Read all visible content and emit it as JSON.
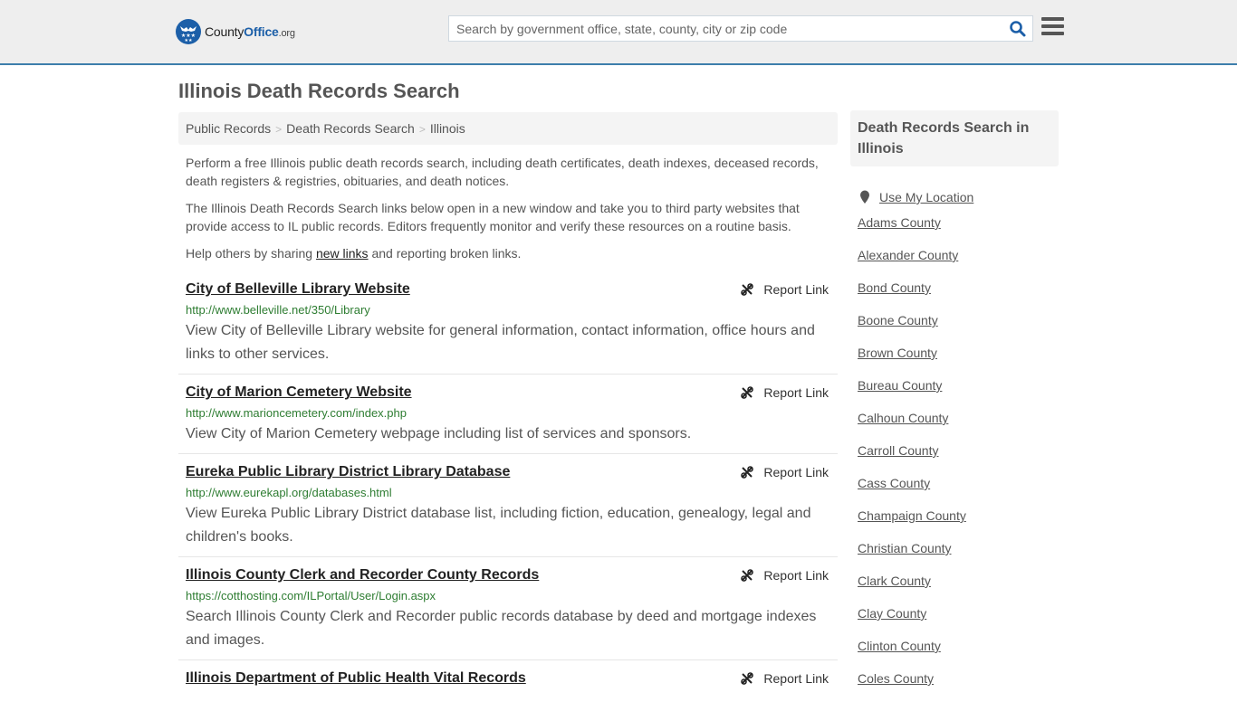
{
  "header": {
    "logo": {
      "prefix": "County",
      "brand": "Office",
      "tld": ".org"
    },
    "search_placeholder": "Search by government office, state, county, city or zip code",
    "search_value": "",
    "icons": {
      "search": "search-icon",
      "menu": "hamburger-menu-icon"
    },
    "accent_color": "#3d7eab"
  },
  "page": {
    "title": "Illinois Death Records Search",
    "breadcrumb": [
      "Public Records",
      "Death Records Search",
      "Illinois"
    ],
    "breadcrumb_separator": ">",
    "intro": [
      "Perform a free Illinois public death records search, including death certificates, death indexes, deceased records, death registers & registries, obituaries, and death notices.",
      "The Illinois Death Records Search links below open in a new window and take you to third party websites that provide access to IL public records. Editors frequently monitor and verify these resources on a routine basis."
    ],
    "help": {
      "prefix": "Help others by sharing ",
      "link": "new links",
      "suffix": " and reporting broken links."
    }
  },
  "results": [
    {
      "title": "City of Belleville Library Website",
      "url": "http://www.belleville.net/350/Library",
      "description": "View City of Belleville Library website for general information, contact information, office hours and links to other services.",
      "report_label": "Report Link"
    },
    {
      "title": "City of Marion Cemetery Website",
      "url": "http://www.marioncemetery.com/index.php",
      "description": "View City of Marion Cemetery webpage including list of services and sponsors.",
      "report_label": "Report Link"
    },
    {
      "title": "Eureka Public Library District Library Database",
      "url": "http://www.eurekapl.org/databases.html",
      "description": "View Eureka Public Library District database list, including fiction, education, genealogy, legal and children's books.",
      "report_label": "Report Link"
    },
    {
      "title": "Illinois County Clerk and Recorder County Records",
      "url": "https://cotthosting.com/ILPortal/User/Login.aspx",
      "description": "Search Illinois County Clerk and Recorder public records database by deed and mortgage indexes and images.",
      "report_label": "Report Link"
    },
    {
      "title": "Illinois Department of Public Health Vital Records",
      "url": "",
      "description": "",
      "report_label": "Report Link"
    }
  ],
  "sidebar": {
    "heading": "Death Records Search in Illinois",
    "use_location": "Use My Location",
    "counties": [
      "Adams County",
      "Alexander County",
      "Bond County",
      "Boone County",
      "Brown County",
      "Bureau County",
      "Calhoun County",
      "Carroll County",
      "Cass County",
      "Champaign County",
      "Christian County",
      "Clark County",
      "Clay County",
      "Clinton County",
      "Coles County"
    ]
  }
}
